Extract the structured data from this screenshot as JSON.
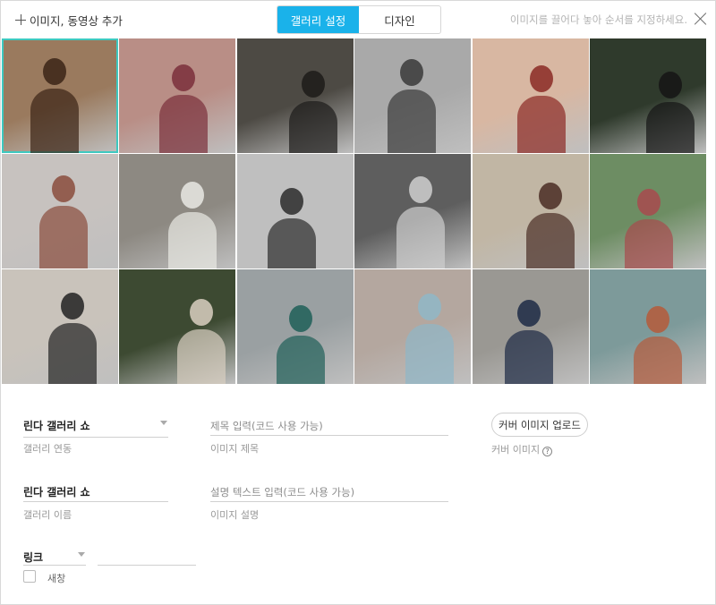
{
  "toolbar": {
    "add_label": "이미지, 동영상 추가",
    "hint": "이미지를 끌어다 놓아 순서를 지정하세요."
  },
  "tabs": [
    {
      "label": "갤러리 설정",
      "active": true
    },
    {
      "label": "디자인",
      "active": false
    }
  ],
  "photos": [
    {
      "desc": "woman with curly hair",
      "bg": "#9a7a5e",
      "accent": "#3b2416",
      "selected": true
    },
    {
      "desc": "woman in patterned sweater",
      "bg": "#b98e86",
      "accent": "#7a2f3b",
      "selected": false
    },
    {
      "desc": "woman with sunglasses",
      "bg": "#4d4a44",
      "accent": "#1d1b19",
      "selected": false
    },
    {
      "desc": "group in city bw",
      "bg": "#a9a9a9",
      "accent": "#3a3a3a",
      "selected": false
    },
    {
      "desc": "woman in red jacket",
      "bg": "#d8b7a2",
      "accent": "#8b2a25",
      "selected": false
    },
    {
      "desc": "woman in dark tank top",
      "bg": "#2f3a2c",
      "accent": "#151515",
      "selected": false
    },
    {
      "desc": "fashion runway",
      "bg": "#c7c2bf",
      "accent": "#8a4c3c",
      "selected": false
    },
    {
      "desc": "woman by old door",
      "bg": "#8d8982",
      "accent": "#e9e9e4",
      "selected": false
    },
    {
      "desc": "woman in field bw",
      "bg": "#bfbfbf",
      "accent": "#2c2c2c",
      "selected": false
    },
    {
      "desc": "woman sitting bw",
      "bg": "#5e5e5e",
      "accent": "#cfcfcf",
      "selected": false
    },
    {
      "desc": "woman against wall",
      "bg": "#c1b6a4",
      "accent": "#4a2d25",
      "selected": false
    },
    {
      "desc": "woman in big hat",
      "bg": "#6d8d63",
      "accent": "#a84a4d",
      "selected": false
    },
    {
      "desc": "woman in alley",
      "bg": "#c9c3bb",
      "accent": "#222222",
      "selected": false
    },
    {
      "desc": "woman in garden",
      "bg": "#3d4a32",
      "accent": "#d9cfc1",
      "selected": false
    },
    {
      "desc": "woman on street",
      "bg": "#9aa0a2",
      "accent": "#1f5f58",
      "selected": false
    },
    {
      "desc": "woman in turtleneck",
      "bg": "#b4a79f",
      "accent": "#8fb7c7",
      "selected": false
    },
    {
      "desc": "woman on steps",
      "bg": "#9a9893",
      "accent": "#1d2a45",
      "selected": false
    },
    {
      "desc": "woman with braids",
      "bg": "#7d9a9a",
      "accent": "#b55a3a",
      "selected": false
    }
  ],
  "form": {
    "gallery_link": {
      "value": "린다 갤러리 쇼",
      "label": "갤러리 연동"
    },
    "title": {
      "placeholder": "제목 입력(코드 사용 가능)",
      "label": "이미지 제목"
    },
    "cover": {
      "button": "커버 이미지 업로드",
      "label": "커버 이미지"
    },
    "gallery_name": {
      "value": "린다 갤러리 쇼",
      "label": "갤러리 이름"
    },
    "description": {
      "placeholder": "설명 텍스트 입력(코드 사용 가능)",
      "label": "이미지 설명"
    },
    "link": {
      "value": "링크",
      "url": ""
    },
    "new_window": {
      "label": "새창",
      "checked": false
    }
  }
}
